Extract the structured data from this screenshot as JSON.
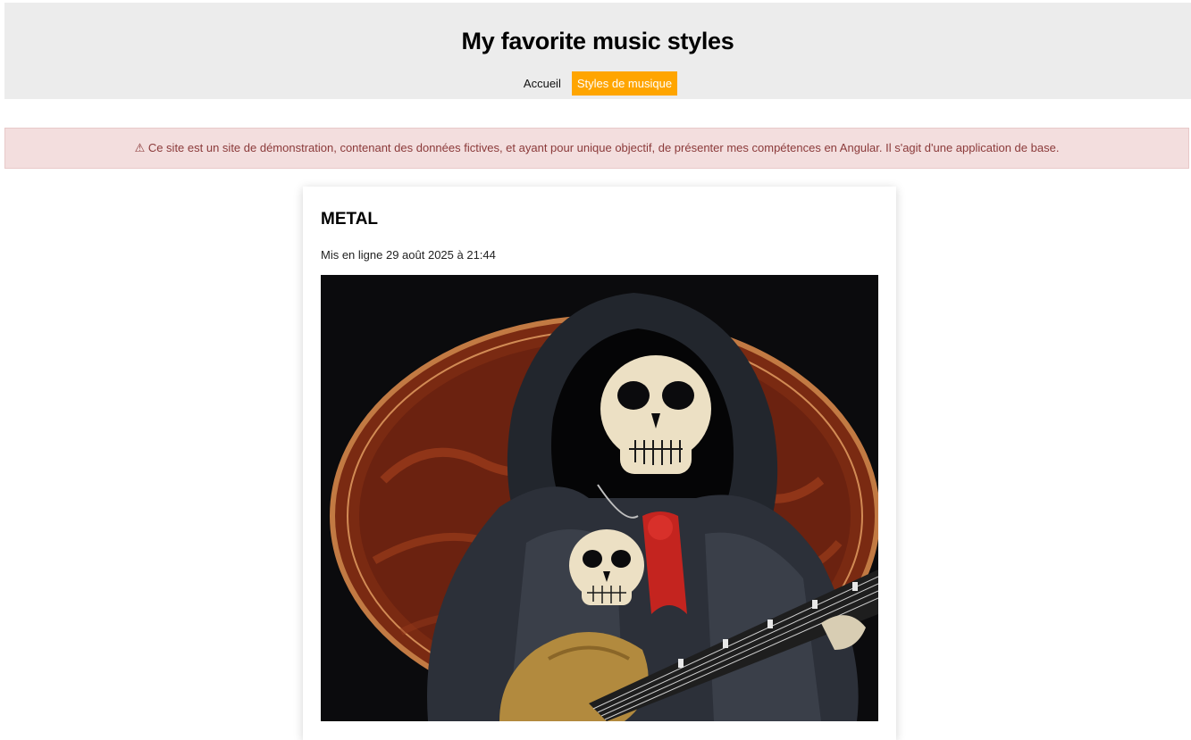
{
  "header": {
    "title": "My favorite music styles",
    "nav": [
      {
        "label": "Accueil",
        "active": false
      },
      {
        "label": "Styles de musique",
        "active": true
      }
    ]
  },
  "alert": {
    "icon": "warning-icon",
    "text": "⚠ Ce site est un site de démonstration, contenant des données fictives, et ayant pour unique objectif, de présenter mes compétences en Angular. Il s'agit d'une application de base."
  },
  "card": {
    "title": "METAL",
    "date": "Mis en ligne 29 août 2025 à 21:44",
    "image": "grim-reaper-guitarist-illustration"
  },
  "colors": {
    "accent": "#ffa500",
    "header_bg": "#ececec",
    "alert_bg": "#f3dede",
    "alert_text": "#8b3a3a"
  }
}
